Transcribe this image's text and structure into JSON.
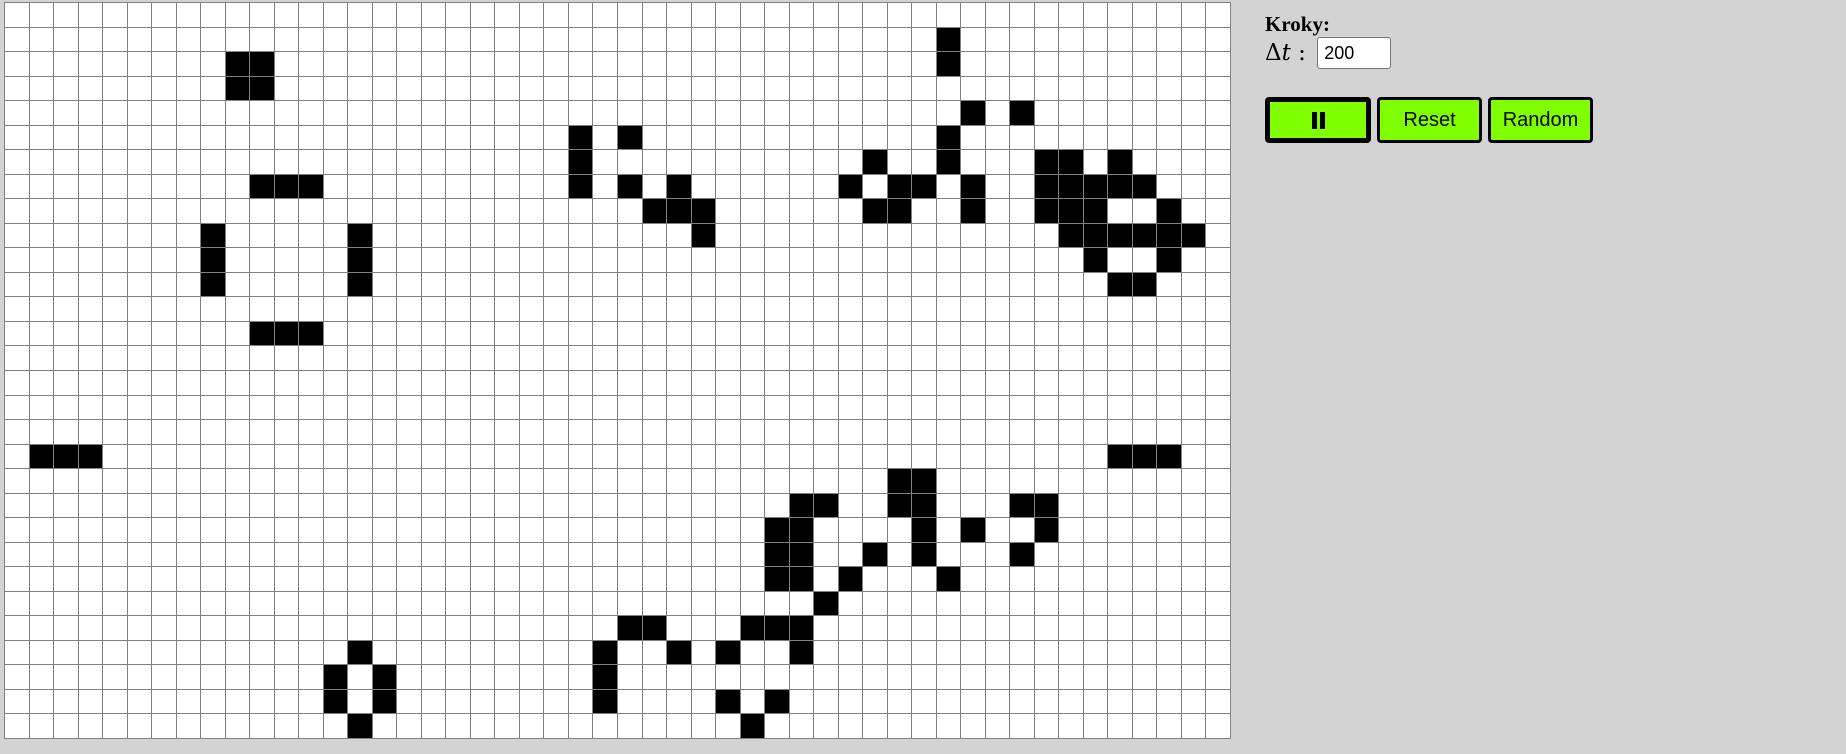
{
  "grid": {
    "cols": 50,
    "rows": 30,
    "alive": [
      [
        1,
        38
      ],
      [
        2,
        9
      ],
      [
        2,
        10
      ],
      [
        2,
        38
      ],
      [
        3,
        9
      ],
      [
        3,
        10
      ],
      [
        4,
        39
      ],
      [
        4,
        41
      ],
      [
        5,
        23
      ],
      [
        5,
        25
      ],
      [
        5,
        38
      ],
      [
        6,
        23
      ],
      [
        6,
        35
      ],
      [
        6,
        38
      ],
      [
        6,
        42
      ],
      [
        6,
        43
      ],
      [
        6,
        45
      ],
      [
        7,
        10
      ],
      [
        7,
        11
      ],
      [
        7,
        12
      ],
      [
        7,
        23
      ],
      [
        7,
        25
      ],
      [
        7,
        27
      ],
      [
        7,
        34
      ],
      [
        7,
        36
      ],
      [
        7,
        37
      ],
      [
        7,
        39
      ],
      [
        7,
        42
      ],
      [
        7,
        43
      ],
      [
        7,
        44
      ],
      [
        7,
        45
      ],
      [
        7,
        46
      ],
      [
        8,
        26
      ],
      [
        8,
        27
      ],
      [
        8,
        28
      ],
      [
        8,
        35
      ],
      [
        8,
        36
      ],
      [
        8,
        39
      ],
      [
        8,
        42
      ],
      [
        8,
        43
      ],
      [
        8,
        44
      ],
      [
        8,
        47
      ],
      [
        9,
        8
      ],
      [
        9,
        14
      ],
      [
        9,
        28
      ],
      [
        9,
        43
      ],
      [
        9,
        44
      ],
      [
        9,
        45
      ],
      [
        9,
        46
      ],
      [
        9,
        47
      ],
      [
        9,
        48
      ],
      [
        10,
        8
      ],
      [
        10,
        14
      ],
      [
        10,
        44
      ],
      [
        10,
        47
      ],
      [
        11,
        8
      ],
      [
        11,
        14
      ],
      [
        11,
        45
      ],
      [
        11,
        46
      ],
      [
        13,
        10
      ],
      [
        13,
        11
      ],
      [
        13,
        12
      ],
      [
        18,
        1
      ],
      [
        18,
        2
      ],
      [
        18,
        3
      ],
      [
        18,
        45
      ],
      [
        18,
        46
      ],
      [
        18,
        47
      ],
      [
        19,
        36
      ],
      [
        19,
        37
      ],
      [
        20,
        32
      ],
      [
        20,
        33
      ],
      [
        20,
        36
      ],
      [
        20,
        37
      ],
      [
        20,
        41
      ],
      [
        20,
        42
      ],
      [
        21,
        31
      ],
      [
        21,
        32
      ],
      [
        21,
        37
      ],
      [
        21,
        39
      ],
      [
        21,
        42
      ],
      [
        22,
        31
      ],
      [
        22,
        32
      ],
      [
        22,
        35
      ],
      [
        22,
        37
      ],
      [
        22,
        41
      ],
      [
        23,
        31
      ],
      [
        23,
        32
      ],
      [
        23,
        34
      ],
      [
        23,
        38
      ],
      [
        24,
        33
      ],
      [
        25,
        25
      ],
      [
        25,
        26
      ],
      [
        25,
        30
      ],
      [
        25,
        31
      ],
      [
        25,
        32
      ],
      [
        26,
        14
      ],
      [
        26,
        24
      ],
      [
        26,
        27
      ],
      [
        26,
        29
      ],
      [
        26,
        32
      ],
      [
        27,
        13
      ],
      [
        27,
        15
      ],
      [
        27,
        24
      ],
      [
        28,
        13
      ],
      [
        28,
        15
      ],
      [
        28,
        24
      ],
      [
        28,
        29
      ],
      [
        28,
        31
      ],
      [
        29,
        14
      ],
      [
        29,
        30
      ]
    ]
  },
  "panel": {
    "steps_label": "Kroky:",
    "dt_symbol": "Δ",
    "dt_var": "t",
    "dt_sep": " : ",
    "dt_value": "200"
  },
  "buttons": {
    "pause_icon": "pause-icon",
    "reset_label": "Reset",
    "random_label": "Random",
    "accent": "#7fff00"
  }
}
